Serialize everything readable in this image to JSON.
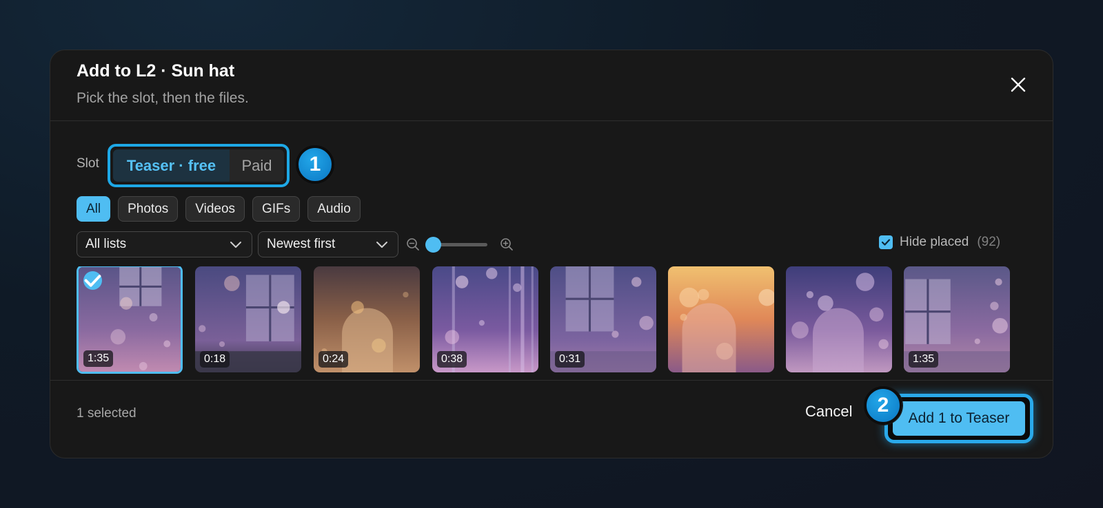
{
  "dialog": {
    "title": "Add to L2 · Sun hat",
    "subtitle": "Pick the slot, then the files."
  },
  "slot": {
    "label": "Slot",
    "options": [
      "Teaser · free",
      "Paid"
    ],
    "selected": "Teaser · free"
  },
  "steps": [
    "1",
    "2"
  ],
  "filters": {
    "chips": [
      "All",
      "Photos",
      "Videos",
      "GIFs",
      "Audio"
    ],
    "active": "All"
  },
  "lists_dropdown": {
    "value": "All lists"
  },
  "sort_dropdown": {
    "value": "Newest first"
  },
  "zoom": {
    "level": 0
  },
  "hide_placed": {
    "label": "Hide placed",
    "count": "(92)",
    "checked": true
  },
  "media": [
    {
      "duration": "1:35",
      "selected": true
    },
    {
      "duration": "0:18",
      "selected": false
    },
    {
      "duration": "0:24",
      "selected": false
    },
    {
      "duration": "0:38",
      "selected": false
    },
    {
      "duration": "0:31",
      "selected": false
    },
    {
      "duration": "",
      "selected": false
    },
    {
      "duration": "",
      "selected": false
    },
    {
      "duration": "1:35",
      "selected": false
    }
  ],
  "footer": {
    "selected_text": "1 selected",
    "cancel_label": "Cancel",
    "primary_label": "Add 1 to Teaser"
  },
  "colors": {
    "accent": "#4fbdf2",
    "badge": "#1497dd",
    "surface": "#181818"
  }
}
